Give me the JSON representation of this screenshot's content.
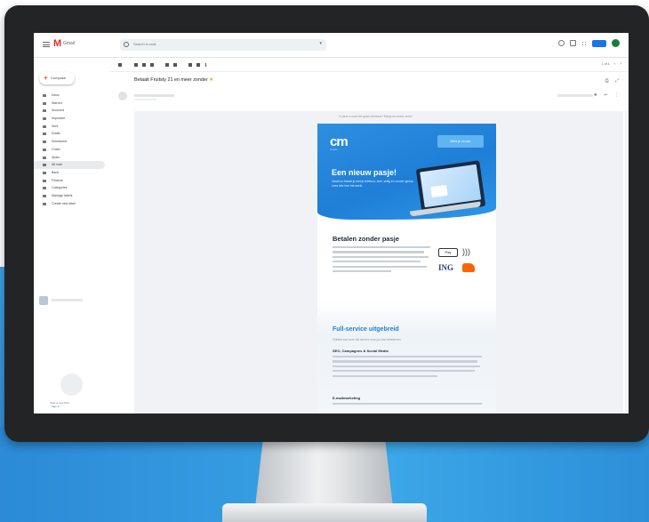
{
  "gmail": {
    "logo_letter": "M",
    "logo_word": "Gmail",
    "search": {
      "placeholder": "Search in mail",
      "caret": "▾"
    },
    "compose_label": "Compose",
    "nav": [
      {
        "label": "Inbox",
        "count": "",
        "active": false
      },
      {
        "label": "Starred",
        "count": "",
        "active": false
      },
      {
        "label": "Snoozed",
        "count": "",
        "active": false
      },
      {
        "label": "Important",
        "count": "",
        "active": false
      },
      {
        "label": "Sent",
        "count": "",
        "active": false
      },
      {
        "label": "Drafts",
        "count": "",
        "active": false
      },
      {
        "label": "Scheduled",
        "count": "",
        "active": false
      },
      {
        "label": "Chats",
        "count": "",
        "active": false
      },
      {
        "label": "Spam",
        "count": "",
        "active": false
      },
      {
        "label": "All mail",
        "count": "",
        "active": true
      },
      {
        "label": "Bank",
        "count": "",
        "active": false
      },
      {
        "label": "Finance",
        "count": "",
        "active": false
      },
      {
        "label": "Categories",
        "count": "",
        "active": false
      },
      {
        "label": "Manage labels",
        "count": "",
        "active": false
      },
      {
        "label": "Create new label",
        "count": "",
        "active": false
      }
    ],
    "sidebar_footer": {
      "line1": "Start a new chat",
      "line2": "Sign in"
    },
    "toolbar": {
      "count_text": "1 of 1",
      "prev": "‹",
      "next": "›"
    },
    "subject": "Betaalt Fruitsty 21 en meer zonder",
    "subject_badge": "★",
    "message_icons": "★ ↩ ⋮",
    "print_icons": "⎙ ⤢"
  },
  "email": {
    "preheader": "Is deze e-mail niet goed zichtbaar? Bekijk de online versie",
    "hero": {
      "logo": "cm",
      "logo_sub": "cm.com",
      "button": "Meld je nu aan",
      "title": "Een nieuw pasje!",
      "text": "Vanaf nu betaal je met je telefoon; snel, veilig en zonder gedoe. Lees hier hoe het werkt."
    },
    "section1": {
      "title": "Betalen zonder pasje",
      "applepay": "Pay",
      "contactless": ")))",
      "ing": "ING"
    },
    "section2": {
      "title": "Full-service uitgebreid",
      "subtitle": "Ontdek wat onze full-service voor jou kan betekenen",
      "heading1": "SEO, Campagnes & Social Media",
      "heading2": "E-mailmarketing"
    }
  },
  "colors": {
    "brand_blue": "#1f7ed6",
    "gmail_red": "#d93025",
    "ing_orange": "#ff6200",
    "monitor_bezel": "#222426"
  }
}
